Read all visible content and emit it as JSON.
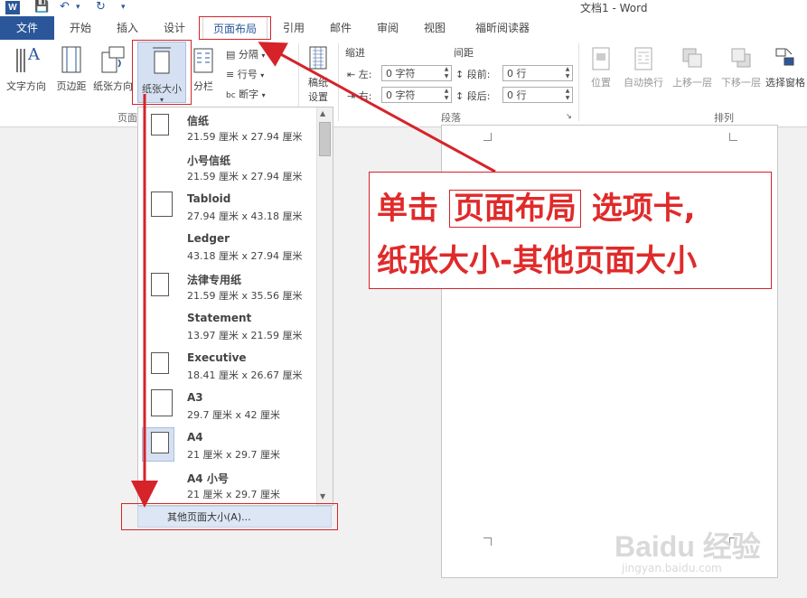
{
  "title_bar": {
    "doc_title": "文档1 - Word",
    "word_logo": "W"
  },
  "tabs": [
    {
      "label": "文件"
    },
    {
      "label": "开始"
    },
    {
      "label": "插入"
    },
    {
      "label": "设计"
    },
    {
      "label": "页面布局"
    },
    {
      "label": "引用"
    },
    {
      "label": "邮件"
    },
    {
      "label": "审阅"
    },
    {
      "label": "视图"
    },
    {
      "label": "福昕阅读器"
    }
  ],
  "ribbon": {
    "page_setup": {
      "group_label": "页面",
      "text_direction": "文字方向",
      "margins": "页边距",
      "orientation": "纸张方向",
      "size": "纸张大小",
      "columns": "分栏",
      "breaks": "分隔",
      "line_numbers": "行号",
      "hyphenation": "断字"
    },
    "manuscript": {
      "label1": "稿纸",
      "label2": "设置"
    },
    "paragraph": {
      "group_label": "段落",
      "indent_title": "缩进",
      "spacing_title": "间距",
      "indent_left_label": "左:",
      "indent_left_value": "0 字符",
      "indent_right_label": "右:",
      "indent_right_value": "0 字符",
      "before_label": "段前:",
      "before_value": "0 行",
      "after_label": "段后:",
      "after_value": "0 行"
    },
    "arrange": {
      "group_label": "排列",
      "position": "位置",
      "wrap_text": "自动换行",
      "bring_forward": "上移一层",
      "send_backward": "下移一层",
      "selection_pane": "选择窗格"
    }
  },
  "paper_sizes": [
    {
      "name": "信纸",
      "dim": "21.59 厘米 x 27.94 厘米",
      "shape": "portrait"
    },
    {
      "name": "小号信纸",
      "dim": "21.59 厘米 x 27.94 厘米",
      "shape": "none"
    },
    {
      "name": "Tabloid",
      "dim": "27.94 厘米 x 43.18 厘米",
      "shape": "portrait"
    },
    {
      "name": "Ledger",
      "dim": "43.18 厘米 x 27.94 厘米",
      "shape": "none"
    },
    {
      "name": "法律专用纸",
      "dim": "21.59 厘米 x 35.56 厘米",
      "shape": "portrait"
    },
    {
      "name": "Statement",
      "dim": "13.97 厘米 x 21.59 厘米",
      "shape": "none"
    },
    {
      "name": "Executive",
      "dim": "18.41 厘米 x 26.67 厘米",
      "shape": "portrait"
    },
    {
      "name": "A3",
      "dim": "29.7 厘米 x 42 厘米",
      "shape": "portrait"
    },
    {
      "name": "A4",
      "dim": "21 厘米 x 29.7 厘米",
      "shape": "portrait",
      "selected": true
    },
    {
      "name": "A4 小号",
      "dim": "21 厘米 x 29.7 厘米",
      "shape": "none"
    }
  ],
  "more_sizes_label": "其他页面大小(A)...",
  "annotation": {
    "line1_a": "单击",
    "line1_b": "页面布局",
    "line1_c": "选项卡,",
    "line2": "纸张大小-其他页面大小"
  },
  "watermark": {
    "line1": "Baidu 经验",
    "line2": "jingyan.baidu.com"
  },
  "colors": {
    "accent": "#2b579a",
    "annotation_red": "#d6232a",
    "selected": "#d5e1f2"
  }
}
